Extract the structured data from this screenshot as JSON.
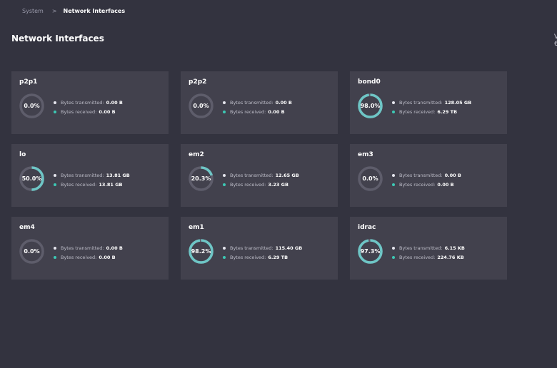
{
  "breadcrumb": {
    "parent": "System",
    "separator": ">",
    "current": "Network Interfaces"
  },
  "page_title": "Network Interfaces",
  "edge_text": "V 6",
  "colors": {
    "background": "#33333f",
    "card": "#42414d",
    "gauge_track": "#5e5d6b",
    "gauge_fill": "#6ec6c6",
    "tx_dot": "#e6e6ee",
    "rx_dot": "#3cc8b4"
  },
  "labels": {
    "transmitted": "Bytes transmitted:",
    "received": "Bytes received:"
  },
  "interfaces": [
    {
      "name": "p2p1",
      "percent": 0.0,
      "percent_label": "0.0%",
      "transmitted": "0.00 B",
      "received": "0.00 B"
    },
    {
      "name": "p2p2",
      "percent": 0.0,
      "percent_label": "0.0%",
      "transmitted": "0.00 B",
      "received": "0.00 B"
    },
    {
      "name": "bond0",
      "percent": 98.0,
      "percent_label": "98.0%",
      "transmitted": "128.05 GB",
      "received": "6.29 TB"
    },
    {
      "name": "lo",
      "percent": 50.0,
      "percent_label": "50.0%",
      "transmitted": "13.81 GB",
      "received": "13.81 GB"
    },
    {
      "name": "em2",
      "percent": 20.3,
      "percent_label": "20.3%",
      "transmitted": "12.65 GB",
      "received": "3.23 GB"
    },
    {
      "name": "em3",
      "percent": 0.0,
      "percent_label": "0.0%",
      "transmitted": "0.00 B",
      "received": "0.00 B"
    },
    {
      "name": "em4",
      "percent": 0.0,
      "percent_label": "0.0%",
      "transmitted": "0.00 B",
      "received": "0.00 B"
    },
    {
      "name": "em1",
      "percent": 98.2,
      "percent_label": "98.2%",
      "transmitted": "115.40 GB",
      "received": "6.29 TB"
    },
    {
      "name": "idrac",
      "percent": 97.3,
      "percent_label": "97.3%",
      "transmitted": "6.15 KB",
      "received": "224.76 KB"
    }
  ]
}
